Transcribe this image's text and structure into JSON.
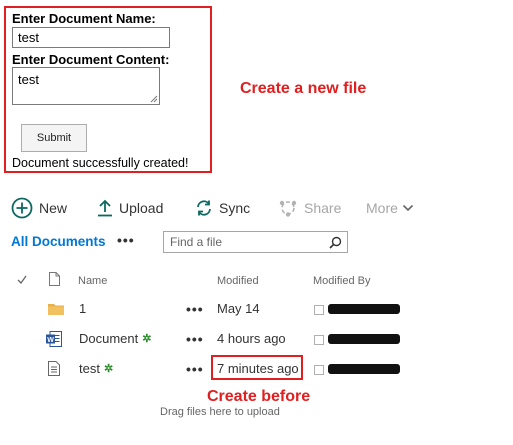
{
  "form": {
    "name_label": "Enter Document Name:",
    "name_value": "test",
    "content_label": "Enter Document Content:",
    "content_value": "test",
    "submit_label": "Submit",
    "status_message": "Document successfully created!"
  },
  "annotations": {
    "create_new": "Create a new file",
    "create_before": "Create before",
    "accent_color": "#e02020"
  },
  "toolbar": {
    "new_label": "New",
    "upload_label": "Upload",
    "sync_label": "Sync",
    "share_label": "Share",
    "more_label": "More"
  },
  "view": {
    "name": "All Documents",
    "more_dots": "•••",
    "search_placeholder": "Find a file"
  },
  "list": {
    "columns": {
      "name": "Name",
      "modified": "Modified",
      "modified_by": "Modified By"
    },
    "rows": [
      {
        "name": "1",
        "type": "folder-icon",
        "modified": "May 14",
        "dots": "•••",
        "is_new": false
      },
      {
        "name": "Document",
        "type": "word-doc-icon",
        "modified": "4 hours ago",
        "dots": "•••",
        "is_new": true,
        "new_mark": "✲"
      },
      {
        "name": "test",
        "type": "text-file-icon",
        "modified": "7 minutes ago",
        "dots": "•••",
        "is_new": true,
        "new_mark": "✲"
      }
    ],
    "drag_hint": "Drag files here to upload"
  }
}
